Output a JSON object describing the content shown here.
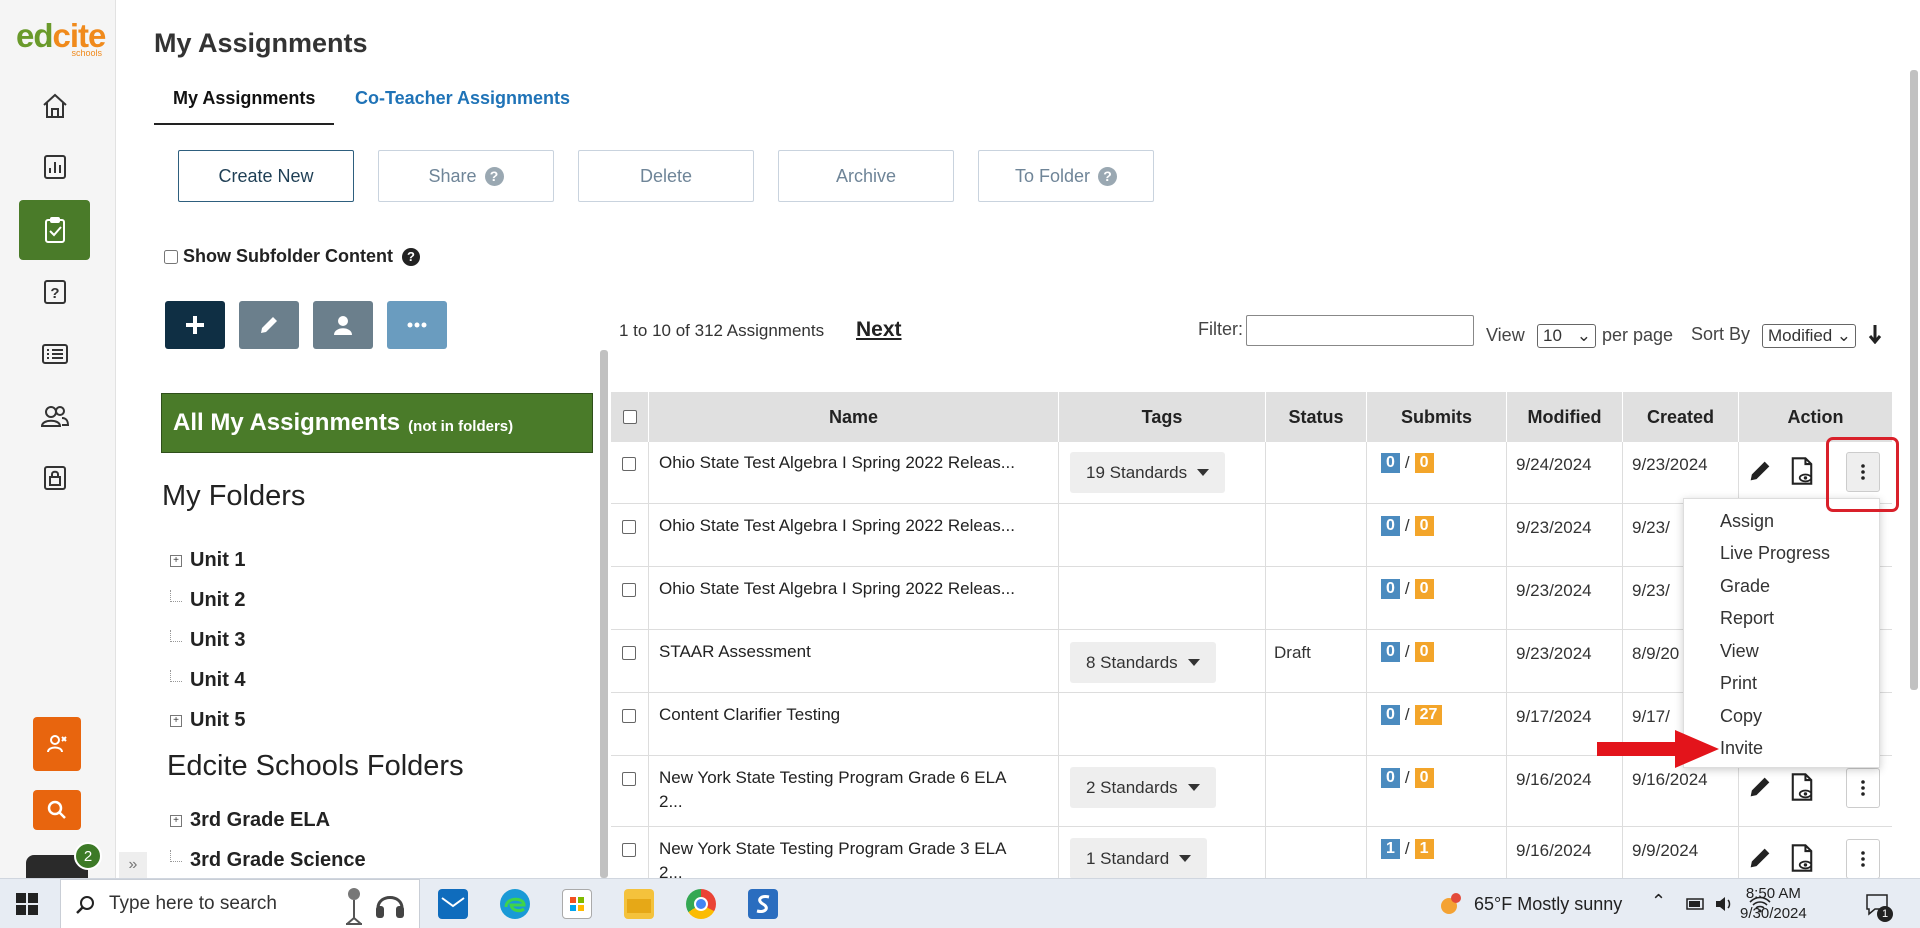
{
  "brand": {
    "logo_text_green": "ed",
    "logo_text_orange": "cite",
    "logo_sub": "schools"
  },
  "page": {
    "title": "My Assignments"
  },
  "tabs": {
    "my": "My Assignments",
    "co": "Co-Teacher Assignments"
  },
  "toolbar": {
    "create": "Create New",
    "share": "Share",
    "delete": "Delete",
    "archive": "Archive",
    "to_folder": "To Folder",
    "help": "?"
  },
  "subfolder": {
    "label": "Show Subfolder Content",
    "help": "?"
  },
  "folders": {
    "all_title": "All My Assignments",
    "all_sub": "(not in folders)",
    "my_heading": "My Folders",
    "my_items": [
      "Unit 1",
      "Unit 2",
      "Unit 3",
      "Unit 4",
      "Unit 5"
    ],
    "school_heading": "Edcite Schools Folders",
    "school_items": [
      "3rd Grade ELA",
      "3rd Grade Science"
    ]
  },
  "list": {
    "count": "1 to 10 of 312 Assignments",
    "next": "Next",
    "filter_label": "Filter:",
    "filter_value": "",
    "view_label": "View",
    "view_value": "10",
    "per_page": "per page",
    "sort_label": "Sort By",
    "sort_value": "Modified"
  },
  "table": {
    "headers": {
      "name": "Name",
      "tags": "Tags",
      "status": "Status",
      "submits": "Submits",
      "modified": "Modified",
      "created": "Created",
      "action": "Action"
    },
    "rows": [
      {
        "name": "Ohio State Test Algebra I Spring 2022 Releas...",
        "tag": "19 Standards",
        "status": "",
        "sub_a": "0",
        "sub_b": "0",
        "modified": "9/24/2024",
        "created": "9/23/2024"
      },
      {
        "name": "Ohio State Test Algebra I Spring 2022 Releas...",
        "tag": "",
        "status": "",
        "sub_a": "0",
        "sub_b": "0",
        "modified": "9/23/2024",
        "created": "9/23/"
      },
      {
        "name": "Ohio State Test Algebra I Spring 2022 Releas...",
        "tag": "",
        "status": "",
        "sub_a": "0",
        "sub_b": "0",
        "modified": "9/23/2024",
        "created": "9/23/"
      },
      {
        "name": "STAAR Assessment",
        "tag": "8 Standards",
        "status": "Draft",
        "sub_a": "0",
        "sub_b": "0",
        "modified": "9/23/2024",
        "created": "8/9/20"
      },
      {
        "name": "Content Clarifier Testing",
        "tag": "",
        "status": "",
        "sub_a": "0",
        "sub_b": "27",
        "modified": "9/17/2024",
        "created": "9/17/"
      },
      {
        "name": "New York State Testing Program Grade 6 ELA 2...",
        "tag": "2 Standards",
        "status": "",
        "sub_a": "0",
        "sub_b": "0",
        "modified": "9/16/2024",
        "created": "9/16/2024"
      },
      {
        "name": "New York State Testing Program Grade 3 ELA 2...",
        "tag": "1 Standard",
        "status": "",
        "sub_a": "1",
        "sub_b": "1",
        "modified": "9/16/2024",
        "created": "9/9/2024"
      }
    ],
    "slash": "/"
  },
  "action_menu": [
    "Assign",
    "Live Progress",
    "Grade",
    "Report",
    "View",
    "Print",
    "Copy",
    "Invite"
  ],
  "chat": {
    "badge": "2"
  },
  "collapse": "»",
  "taskbar": {
    "search_placeholder": "Type here to search",
    "weather": "65°F  Mostly sunny",
    "time": "8:50 AM",
    "date": "9/30/2024",
    "notif": "1"
  },
  "colors": {
    "brand_green": "#4a7b29",
    "accent_orange": "#e8650e",
    "highlight_red": "#d9202a",
    "link_blue": "#1f73b7"
  }
}
